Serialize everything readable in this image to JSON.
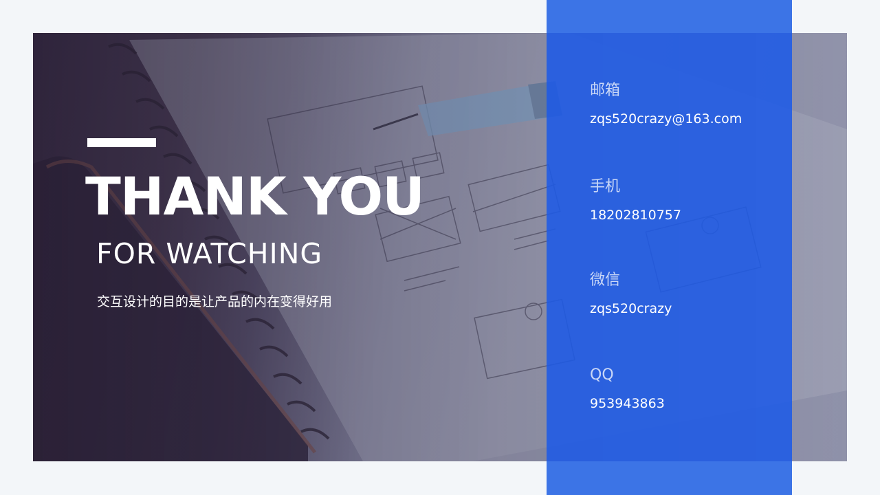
{
  "slide": {
    "title": "THANK YOU",
    "subtitle": "FOR WATCHING",
    "tagline": "交互设计的目的是让产品的内在变得好用"
  },
  "contacts": [
    {
      "label": "邮箱",
      "value": "zqs520crazy@163.com"
    },
    {
      "label": "手机",
      "value": "18202810757"
    },
    {
      "label": "微信",
      "value": "zqs520crazy"
    },
    {
      "label": "QQ",
      "value": "953943863"
    }
  ],
  "colors": {
    "panel_blue": "#1e5ae6",
    "background": "#f3f6f9",
    "text": "#ffffff"
  }
}
